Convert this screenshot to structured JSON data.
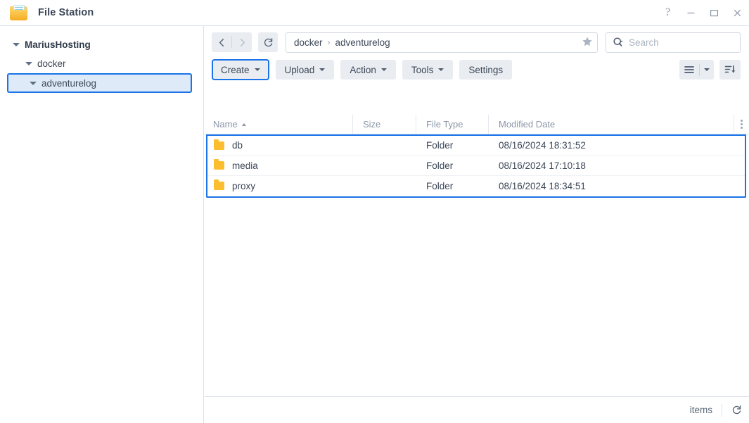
{
  "window": {
    "title": "File Station",
    "icon": "folder-app-icon",
    "controls": [
      {
        "name": "help-button",
        "glyph": "?"
      },
      {
        "name": "minimize-button",
        "glyph": "—"
      },
      {
        "name": "maximize-button",
        "glyph": "□"
      },
      {
        "name": "close-button",
        "glyph": "✕"
      }
    ]
  },
  "sidebar": {
    "items": [
      {
        "label": "MariusHosting",
        "level": 0,
        "expanded": true,
        "selected": false
      },
      {
        "label": "docker",
        "level": 1,
        "expanded": true,
        "selected": false
      },
      {
        "label": "adventurelog",
        "level": 2,
        "expanded": true,
        "selected": true
      }
    ]
  },
  "nav": {
    "back_icon": "chevron-left-icon",
    "forward_icon": "chevron-right-icon",
    "refresh_icon": "refresh-icon",
    "breadcrumb": [
      "docker",
      "adventurelog"
    ],
    "breadcrumb_separator": "›",
    "favorite_icon": "star-icon",
    "search": {
      "icon": "search-icon",
      "placeholder": "Search",
      "value": ""
    }
  },
  "toolbar": {
    "buttons": [
      {
        "label": "Create",
        "dropdown": true,
        "focused": true
      },
      {
        "label": "Upload",
        "dropdown": true,
        "focused": false
      },
      {
        "label": "Action",
        "dropdown": true,
        "focused": false
      },
      {
        "label": "Tools",
        "dropdown": true,
        "focused": false
      },
      {
        "label": "Settings",
        "dropdown": false,
        "focused": false
      }
    ],
    "view_icon": "list-view-icon",
    "view_caret_icon": "chevron-down-icon",
    "sort_icon": "sort-descending-icon"
  },
  "table": {
    "columns": [
      {
        "key": "name",
        "label": "Name",
        "sorted": "asc"
      },
      {
        "key": "size",
        "label": "Size",
        "sorted": null
      },
      {
        "key": "type",
        "label": "File Type",
        "sorted": null
      },
      {
        "key": "date",
        "label": "Modified Date",
        "sorted": null
      }
    ],
    "options_icon": "more-vertical-icon",
    "rows": [
      {
        "icon": "folder-icon",
        "name": "db",
        "size": "",
        "type": "Folder",
        "date": "08/16/2024 18:31:52"
      },
      {
        "icon": "folder-icon",
        "name": "media",
        "size": "",
        "type": "Folder",
        "date": "08/16/2024 17:10:18"
      },
      {
        "icon": "folder-icon",
        "name": "proxy",
        "size": "",
        "type": "Folder",
        "date": "08/16/2024 18:34:51"
      }
    ],
    "selection_highlight": true
  },
  "status": {
    "items_label": "items",
    "refresh_icon": "refresh-icon"
  },
  "colors": {
    "accent": "#1a73e8",
    "selection_bg": "#dfeaf9",
    "button_bg": "#e9edf2",
    "folder": "#fcbe2e",
    "text": "#3c4757",
    "muted": "#8b96a6",
    "border": "#dde3ea"
  }
}
